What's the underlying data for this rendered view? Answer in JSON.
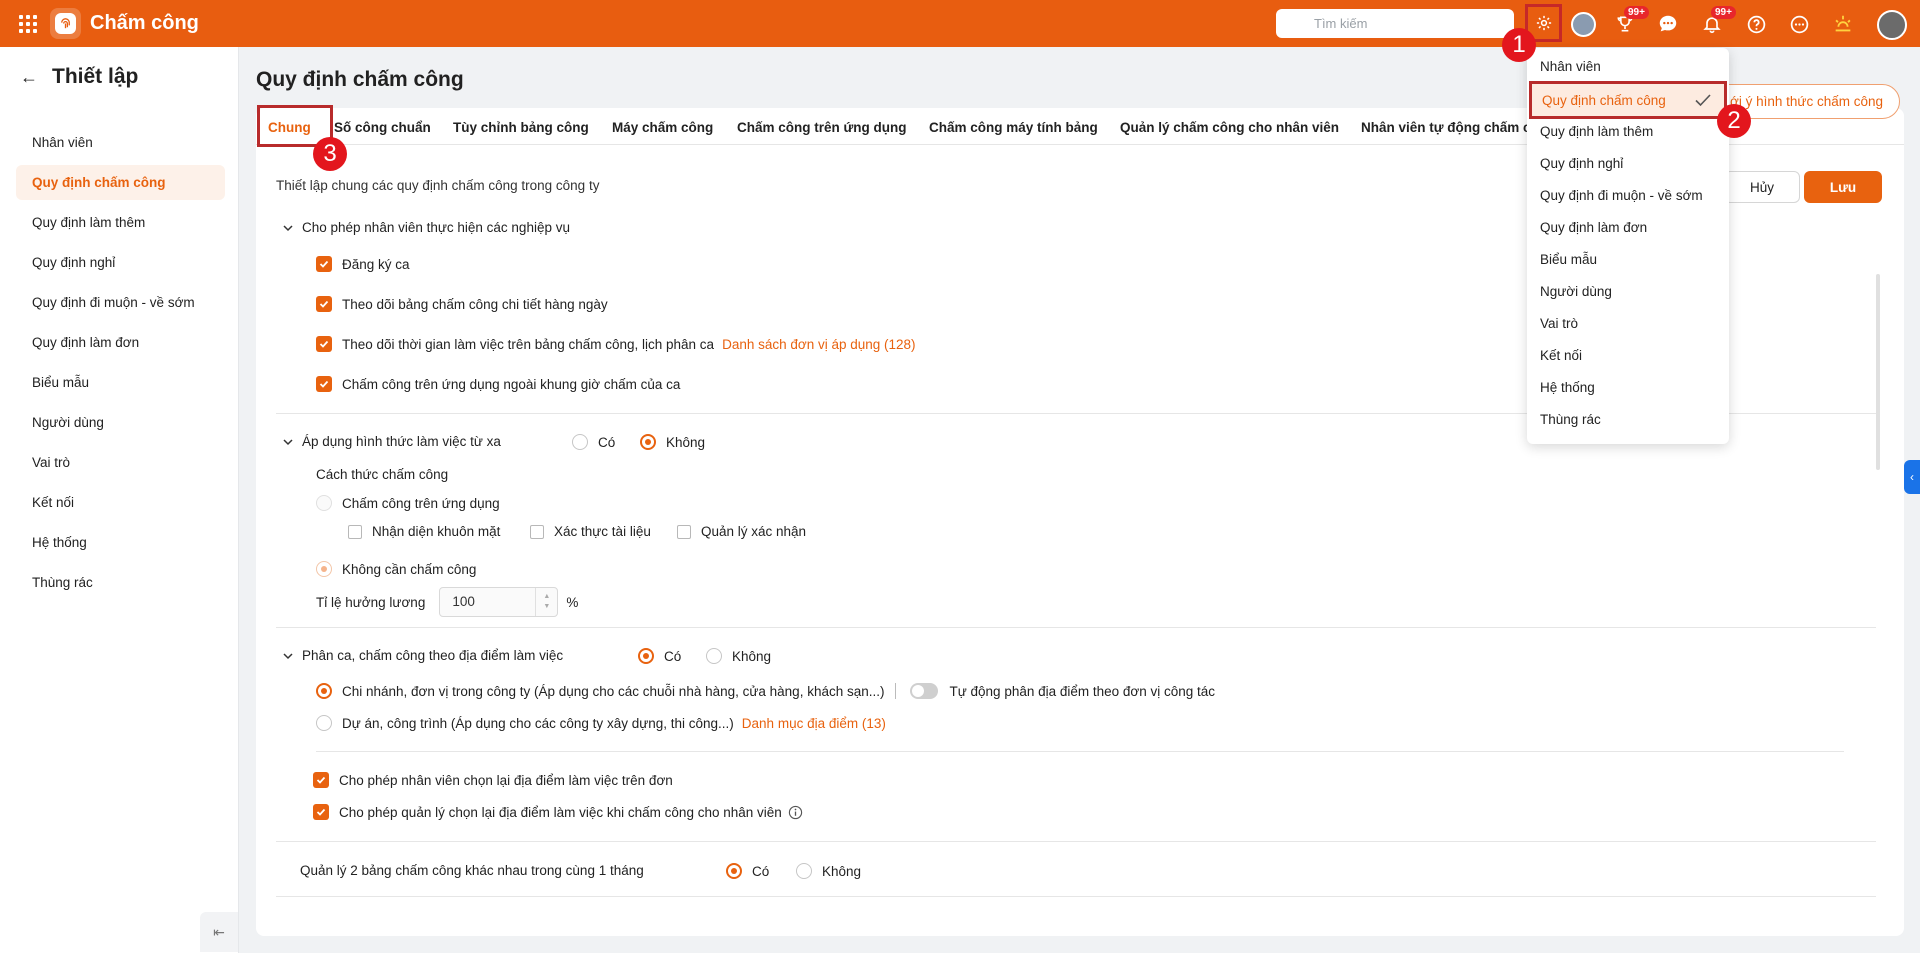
{
  "header": {
    "app_title": "Chấm công",
    "search_placeholder": "Tìm kiếm",
    "badge_goals": "99+",
    "badge_notifications": "99+"
  },
  "sidebar": {
    "title": "Thiết lập",
    "items": [
      {
        "label": "Nhân viên"
      },
      {
        "label": "Quy định chấm công",
        "active": true
      },
      {
        "label": "Quy định làm thêm"
      },
      {
        "label": "Quy định nghỉ"
      },
      {
        "label": "Quy định đi muộn - về sớm"
      },
      {
        "label": "Quy định làm đơn"
      },
      {
        "label": "Biểu mẫu"
      },
      {
        "label": "Người dùng"
      },
      {
        "label": "Vai trò"
      },
      {
        "label": "Kết nối"
      },
      {
        "label": "Hệ thống"
      },
      {
        "label": "Thùng rác"
      }
    ]
  },
  "page": {
    "title": "Quy định chấm công",
    "hint_button": "ới ý hình thức chấm công",
    "tabs": [
      {
        "label": "Chung",
        "active": true
      },
      {
        "label": "Số công chuẩn"
      },
      {
        "label": "Tùy chỉnh bảng công"
      },
      {
        "label": "Máy chấm công"
      },
      {
        "label": "Chấm công trên ứng dụng"
      },
      {
        "label": "Chấm công máy tính bảng"
      },
      {
        "label": "Quản lý chấm công cho nhân viên"
      },
      {
        "label": "Nhân viên tự động chấm c"
      }
    ],
    "description": "Thiết lập chung các quy định chấm công trong công ty",
    "cancel_label": "Hủy",
    "save_label": "Lưu"
  },
  "section1": {
    "title": "Cho phép nhân viên thực hiện các nghiệp vụ",
    "items": [
      "Đăng ký ca",
      "Theo dõi bảng chấm công chi tiết hàng ngày",
      "Theo dõi thời gian làm việc trên bảng chấm công, lịch phân ca",
      "Chấm công trên ứng dụng ngoài khung giờ chấm của ca"
    ],
    "link": "Danh sách đơn vị áp dụng (128)"
  },
  "section2": {
    "title": "Áp dụng hình thức làm việc từ xa",
    "opt_yes": "Có",
    "opt_no": "Không",
    "method_label": "Cách thức chấm công",
    "method_app": "Chấm công trên ứng dụng",
    "face": "Nhận diện khuôn mặt",
    "doc": "Xác thực tài liệu",
    "manager": "Quản lý xác nhận",
    "no_need": "Không cần chấm công",
    "salary_label": "Tỉ lệ hưởng lương",
    "salary_value": "100",
    "percent": "%"
  },
  "section3": {
    "title": "Phân ca, chấm công theo địa điểm làm việc",
    "opt_yes": "Có",
    "opt_no": "Không",
    "branch": "Chi nhánh, đơn vị trong công ty (Áp dụng cho các chuỗi nhà hàng, cửa hàng, khách sạn...)",
    "auto_assign": "Tự động phân địa điểm theo đơn vị công tác",
    "project": "Dự án, công trình (Áp dụng cho các công ty xây dựng, thi công...)",
    "location_link": "Danh mục địa điểm (13)",
    "allow_emp": "Cho phép nhân viên chọn lại địa điểm làm việc trên đơn",
    "allow_mgr": "Cho phép quản lý chọn lại địa điểm làm việc khi chấm công cho nhân viên"
  },
  "section4": {
    "title": "Quản lý 2 bảng chấm công khác nhau trong cùng 1 tháng",
    "opt_yes": "Có",
    "opt_no": "Không"
  },
  "settings_menu": {
    "items": [
      "Nhân viên",
      "Quy định chấm công",
      "Quy định làm thêm",
      "Quy định nghỉ",
      "Quy định đi muộn - về sớm",
      "Quy định làm đơn",
      "Biểu mẫu",
      "Người dùng",
      "Vai trò",
      "Kết nối",
      "Hệ thống",
      "Thùng rác"
    ],
    "active_index": 1
  },
  "markers": [
    "1",
    "2",
    "3"
  ],
  "colors": {
    "brand": "#e85d10",
    "accent": "#e8620f",
    "highlight_box": "#b82b2b",
    "marker": "#e3161d"
  }
}
